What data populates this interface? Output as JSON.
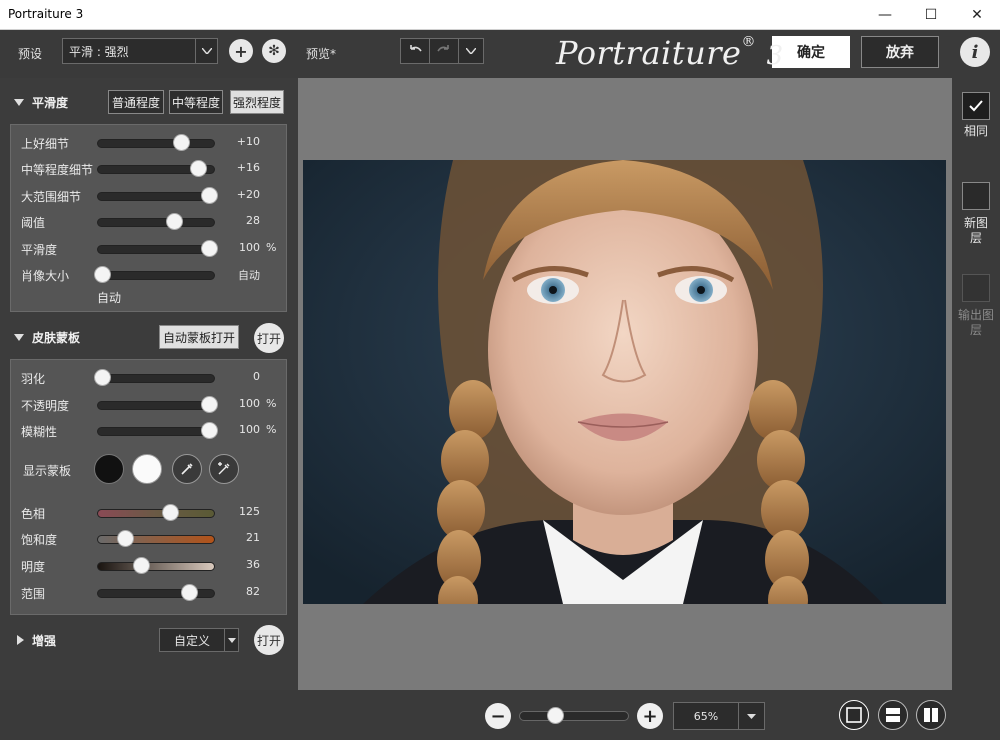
{
  "window": {
    "title": "Portraiture 3",
    "minimize": "—",
    "maximize": "☐",
    "close": "✕"
  },
  "toolbar": {
    "preset_label": "预设",
    "preset_value": "平滑 : 强烈",
    "preview_label": "预览*",
    "ok_label": "确定",
    "cancel_label": "放弃",
    "info_label": "i",
    "logo_text": "Portraiture",
    "logo_reg": "®",
    "logo_version": "3"
  },
  "smoothing": {
    "title": "平滑度",
    "levels": [
      "普通程度",
      "中等程度",
      "强烈程度"
    ],
    "active_level": "强烈程度",
    "sliders": [
      {
        "label": "上好细节",
        "value": "+10",
        "unit": "",
        "pos": 0.72
      },
      {
        "label": "中等程度细节",
        "value": "+16",
        "unit": "",
        "pos": 0.86
      },
      {
        "label": "大范围细节",
        "value": "+20",
        "unit": "",
        "pos": 0.95
      },
      {
        "label": "阈值",
        "value": "28",
        "unit": "",
        "pos": 0.66
      },
      {
        "label": "平滑度",
        "value": "100",
        "unit": "%",
        "pos": 0.95
      },
      {
        "label": "肖像大小",
        "value": "自动",
        "unit": "",
        "pos": 0.05
      }
    ],
    "portrait_size_note": "自动"
  },
  "skinmask": {
    "title": "皮肤蒙板",
    "auto_mask_label": "自动蒙板打开",
    "toggle_label": "打开",
    "sliders": [
      {
        "label": "羽化",
        "value": "0",
        "unit": "",
        "pos": 0.05
      },
      {
        "label": "不透明度",
        "value": "100",
        "unit": "%",
        "pos": 0.95
      },
      {
        "label": "模糊性",
        "value": "100",
        "unit": "%",
        "pos": 0.95
      }
    ],
    "show_mask_label": "显示蒙板",
    "color_sliders": [
      {
        "label": "色相",
        "value": "125",
        "pos": 0.62,
        "gradient": "linear-gradient(90deg,#8a4a55,#6a5a45,#5a5a35)"
      },
      {
        "label": "饱和度",
        "value": "21",
        "pos": 0.24,
        "gradient": "linear-gradient(90deg,#6a6a6a,#b2531a)"
      },
      {
        "label": "明度",
        "value": "36",
        "pos": 0.38,
        "gradient": "linear-gradient(90deg,#1a1410,#d8c8bc)"
      },
      {
        "label": "范围",
        "value": "82",
        "pos": 0.78,
        "gradient": ""
      }
    ]
  },
  "enhance": {
    "title": "增强",
    "preset_value": "自定义",
    "toggle_label": "打开"
  },
  "right_panel": {
    "same_label": "相同",
    "new_layer_label": "新图层",
    "output_layer_label": "输出图层"
  },
  "bottom": {
    "zoom_value": "65%",
    "zoom_pos": 0.33
  }
}
